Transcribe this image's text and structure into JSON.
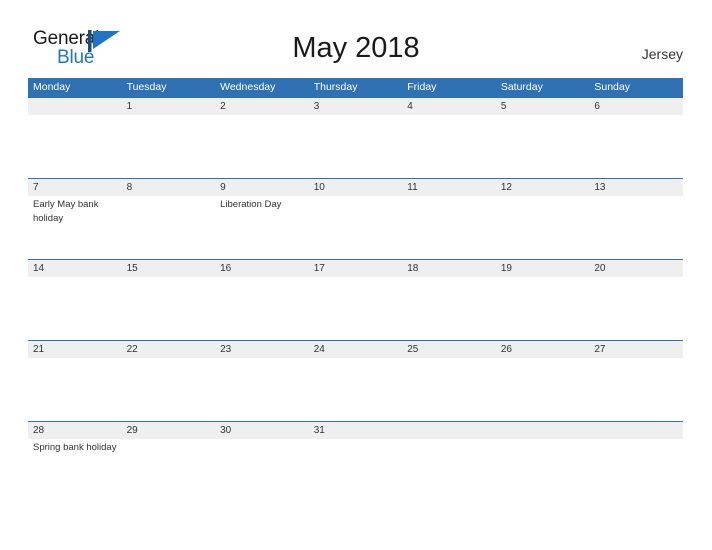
{
  "brand": {
    "name_part1": "General",
    "name_part2": "Blue",
    "flag_icon": "blue-flag-triangle-icon",
    "accent_color": "#1f74c4"
  },
  "header": {
    "title": "May 2018",
    "country": "Jersey"
  },
  "theme": {
    "header_blue": "#2f71b3",
    "band_gray": "#efefef",
    "text_dark": "#333333",
    "page_background": "#ffffff"
  },
  "calendar": {
    "month": "May",
    "year": "2018",
    "weekday_headers": [
      "Monday",
      "Tuesday",
      "Wednesday",
      "Thursday",
      "Friday",
      "Saturday",
      "Sunday"
    ],
    "weeks": [
      {
        "days": [
          {
            "num": "",
            "events": []
          },
          {
            "num": "1",
            "events": []
          },
          {
            "num": "2",
            "events": []
          },
          {
            "num": "3",
            "events": []
          },
          {
            "num": "4",
            "events": []
          },
          {
            "num": "5",
            "events": []
          },
          {
            "num": "6",
            "events": []
          }
        ]
      },
      {
        "days": [
          {
            "num": "7",
            "events": [
              "Early May bank holiday"
            ]
          },
          {
            "num": "8",
            "events": []
          },
          {
            "num": "9",
            "events": [
              "Liberation Day"
            ]
          },
          {
            "num": "10",
            "events": []
          },
          {
            "num": "11",
            "events": []
          },
          {
            "num": "12",
            "events": []
          },
          {
            "num": "13",
            "events": []
          }
        ]
      },
      {
        "days": [
          {
            "num": "14",
            "events": []
          },
          {
            "num": "15",
            "events": []
          },
          {
            "num": "16",
            "events": []
          },
          {
            "num": "17",
            "events": []
          },
          {
            "num": "18",
            "events": []
          },
          {
            "num": "19",
            "events": []
          },
          {
            "num": "20",
            "events": []
          }
        ]
      },
      {
        "days": [
          {
            "num": "21",
            "events": []
          },
          {
            "num": "22",
            "events": []
          },
          {
            "num": "23",
            "events": []
          },
          {
            "num": "24",
            "events": []
          },
          {
            "num": "25",
            "events": []
          },
          {
            "num": "26",
            "events": []
          },
          {
            "num": "27",
            "events": []
          }
        ]
      },
      {
        "days": [
          {
            "num": "28",
            "events": [
              "Spring bank holiday"
            ]
          },
          {
            "num": "29",
            "events": []
          },
          {
            "num": "30",
            "events": []
          },
          {
            "num": "31",
            "events": []
          },
          {
            "num": "",
            "events": []
          },
          {
            "num": "",
            "events": []
          },
          {
            "num": "",
            "events": []
          }
        ]
      }
    ]
  }
}
